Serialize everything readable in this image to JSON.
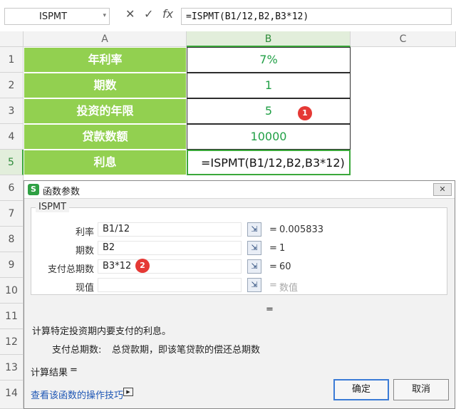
{
  "formula_bar": {
    "name_box": "ISPMT",
    "name_box_arrow": "▾",
    "cancel": "✕",
    "confirm": "✓",
    "fx": "fx",
    "formula": "=ISPMT(B1/12,B2,B3*12)"
  },
  "columns": [
    "A",
    "B",
    "C"
  ],
  "rows": [
    {
      "num": "1",
      "label": "年利率",
      "value": "7%"
    },
    {
      "num": "2",
      "label": "期数",
      "value": "1"
    },
    {
      "num": "3",
      "label": "投资的年限",
      "value": "5"
    },
    {
      "num": "4",
      "label": "贷款数额",
      "value": "10000"
    },
    {
      "num": "5",
      "label": "利息",
      "value": "=ISPMT(B1/12,B2,B3*12)"
    }
  ],
  "other_rows": [
    "6",
    "7",
    "8",
    "9",
    "10",
    "11",
    "12",
    "13",
    "14"
  ],
  "badges": [
    "1",
    "2"
  ],
  "dialog": {
    "logo": "S",
    "title": "函数参数",
    "close": "✕",
    "group": "ISPMT",
    "params": [
      {
        "label": "利率",
        "value": "B1/12",
        "result": "0.005833"
      },
      {
        "label": "期数",
        "value": "B2",
        "result": "1"
      },
      {
        "label": "支付总期数",
        "value": "B3*12",
        "result": "60"
      },
      {
        "label": "现值",
        "value": "",
        "result": "数值"
      }
    ],
    "eq": "=",
    "collapse_icon": "⇲",
    "summary_eq": "=",
    "description": "计算特定投资期内要支付的利息。",
    "param_desc_label": "支付总期数:",
    "param_desc": "总贷款期，即该笔贷款的偿还总期数",
    "result_label": "计算结果",
    "result_eq": "=",
    "help_link": "查看该函数的操作技巧",
    "help_icon": "▶",
    "ok": "确定",
    "cancel": "取消"
  },
  "colors": {
    "header_green": "#92d050",
    "value_green": "#21a046",
    "badge_red": "#e53935"
  }
}
